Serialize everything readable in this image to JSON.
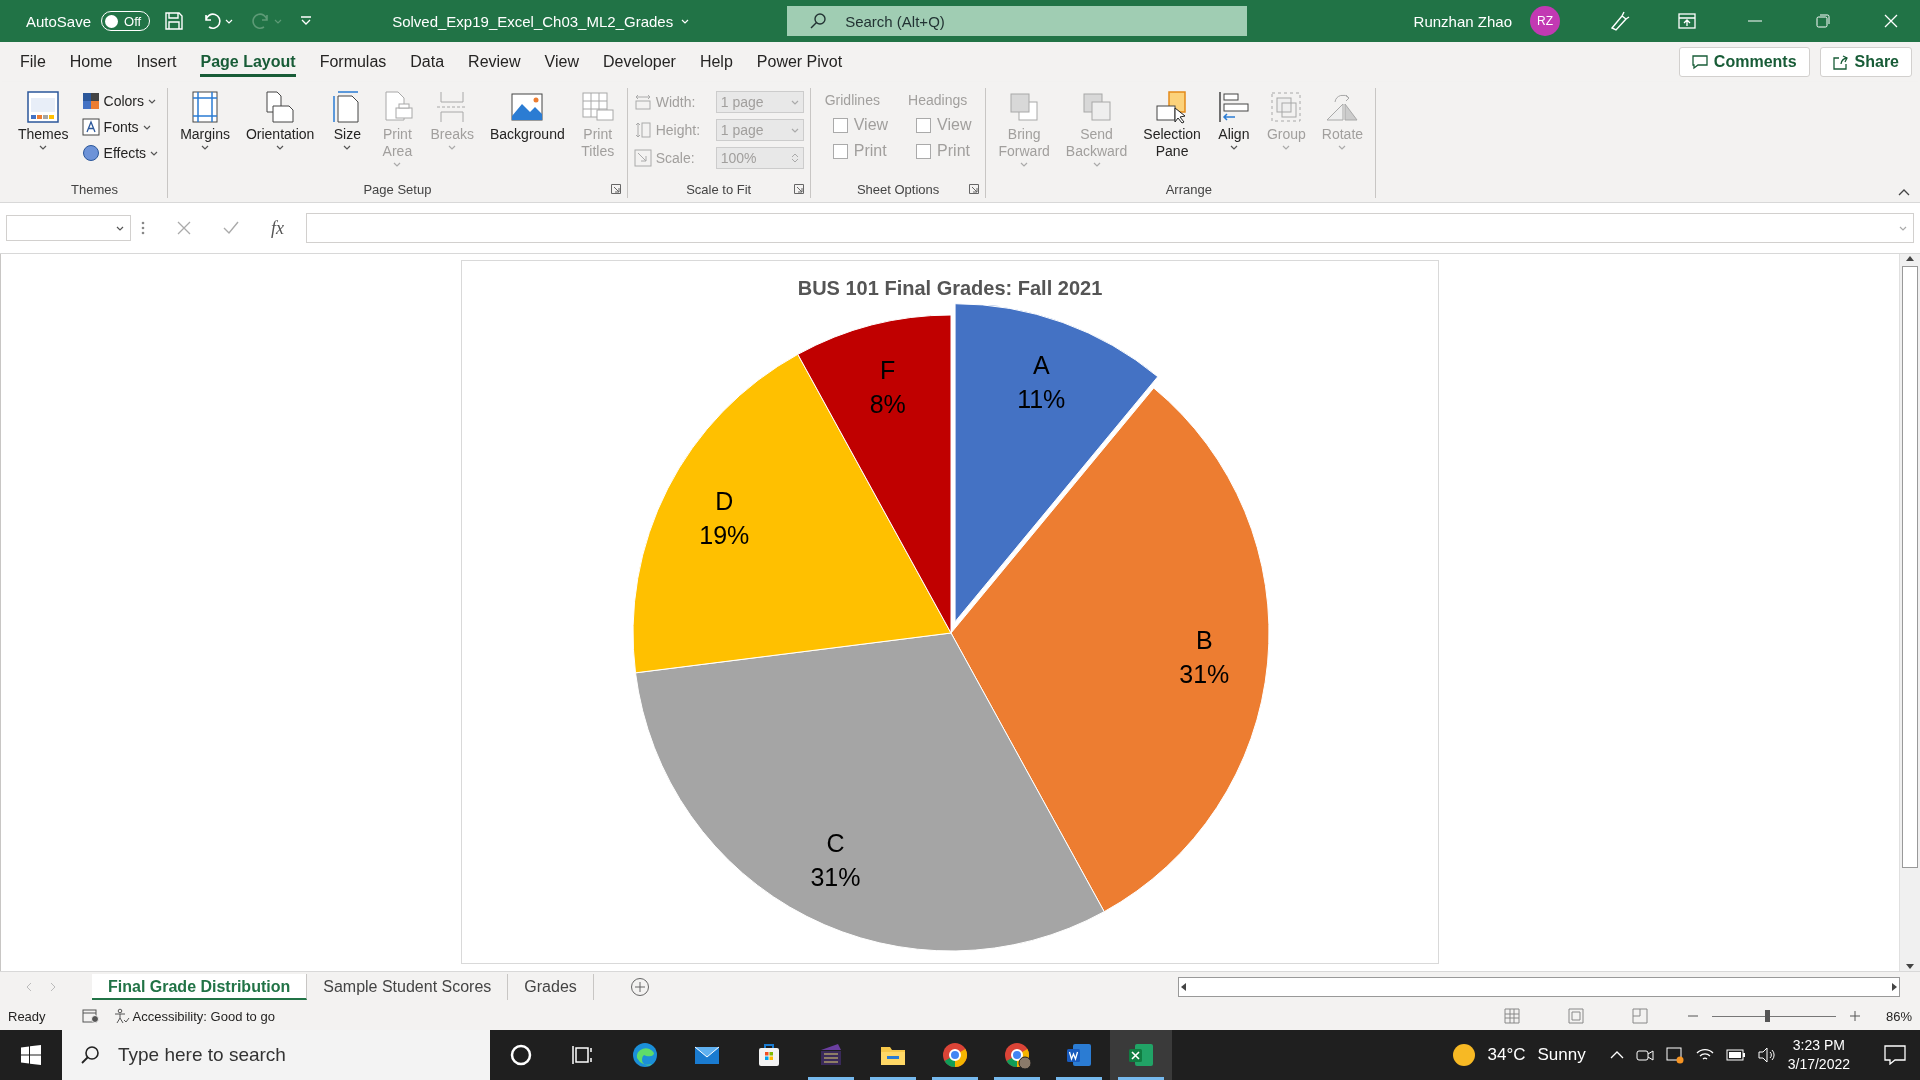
{
  "title_bar": {
    "autosave": {
      "label": "AutoSave",
      "on": false,
      "state_text": "Off"
    },
    "quick_access": [
      {
        "disabled": false
      },
      {
        "disabled": false
      },
      {
        "disabled": true
      },
      {
        "disabled": false
      }
    ],
    "file_name": "Solved_Exp19_Excel_Ch03_ML2_Grades",
    "search": {
      "placeholder": "Search (Alt+Q)"
    },
    "user_name": "Runzhan Zhao",
    "avatar_initials": "RZ"
  },
  "menu_tabs": [
    {
      "label": "File",
      "selected": false
    },
    {
      "label": "Home",
      "selected": false
    },
    {
      "label": "Insert",
      "selected": false
    },
    {
      "label": "Page Layout",
      "selected": true
    },
    {
      "label": "Formulas",
      "selected": false
    },
    {
      "label": "Data",
      "selected": false
    },
    {
      "label": "Review",
      "selected": false
    },
    {
      "label": "View",
      "selected": false
    },
    {
      "label": "Developer",
      "selected": false
    },
    {
      "label": "Help",
      "selected": false
    },
    {
      "label": "Power Pivot",
      "selected": false
    }
  ],
  "header_buttons": [
    "Comments",
    "Share"
  ],
  "ribbon": {
    "groups": [
      {
        "name": "Themes",
        "launcher": false,
        "items": [
          {
            "kind": "large",
            "label": "Themes",
            "dropdown": true,
            "disabled": false
          },
          {
            "kind": "small",
            "label": "Colors",
            "dropdown": true,
            "disabled": false
          },
          {
            "kind": "small",
            "label": "Fonts",
            "dropdown": true,
            "disabled": false
          },
          {
            "kind": "small",
            "label": "Effects",
            "dropdown": true,
            "disabled": false
          }
        ]
      },
      {
        "name": "Page Setup",
        "launcher": true,
        "items": [
          {
            "kind": "large",
            "label": "Margins",
            "dropdown": true,
            "disabled": false
          },
          {
            "kind": "large",
            "label": "Orientation",
            "dropdown": true,
            "disabled": false
          },
          {
            "kind": "large",
            "label": "Size",
            "dropdown": true,
            "disabled": false
          },
          {
            "kind": "large",
            "label": "Print Area",
            "dropdown": true,
            "disabled": true
          },
          {
            "kind": "large",
            "label": "Breaks",
            "dropdown": true,
            "disabled": true
          },
          {
            "kind": "large",
            "label": "Background",
            "dropdown": false,
            "disabled": false
          },
          {
            "kind": "large",
            "label": "Print Titles",
            "dropdown": false,
            "disabled": true
          }
        ]
      },
      {
        "name": "Scale to Fit",
        "launcher": true,
        "items": [
          {
            "kind": "combo",
            "label": "Width:",
            "value": "1 page",
            "disabled": true
          },
          {
            "kind": "combo",
            "label": "Height:",
            "value": "1 page",
            "disabled": true
          },
          {
            "kind": "spin",
            "label": "Scale:",
            "value": "100%",
            "disabled": true
          }
        ]
      },
      {
        "name": "Sheet Options",
        "launcher": true,
        "items": [
          {
            "kind": "checks",
            "label": "Gridlines",
            "disabled": true,
            "checks": [
              {
                "label": "View",
                "checked": false
              },
              {
                "label": "Print",
                "checked": false
              }
            ]
          },
          {
            "kind": "checks",
            "label": "Headings",
            "disabled": true,
            "checks": [
              {
                "label": "View",
                "checked": false
              },
              {
                "label": "Print",
                "checked": false
              }
            ]
          }
        ]
      },
      {
        "name": "Arrange",
        "launcher": false,
        "items": [
          {
            "kind": "large",
            "label": "Bring Forward",
            "dropdown": true,
            "disabled": true
          },
          {
            "kind": "large",
            "label": "Send Backward",
            "dropdown": true,
            "disabled": true
          },
          {
            "kind": "large",
            "label": "Selection Pane",
            "dropdown": false,
            "disabled": false
          },
          {
            "kind": "large",
            "label": "Align",
            "dropdown": true,
            "disabled": false
          },
          {
            "kind": "large",
            "label": "Group",
            "dropdown": true,
            "disabled": true
          },
          {
            "kind": "large",
            "label": "Rotate",
            "dropdown": true,
            "disabled": true
          }
        ]
      }
    ]
  },
  "formula_bar": {
    "fx_label": "fx"
  },
  "chart": {
    "chart_data": {
      "type": "pie",
      "title": "BUS 101 Final Grades: Fall 2021",
      "categories": [
        "A",
        "B",
        "C",
        "D",
        "F"
      ],
      "series": [
        {
          "values": [
            11,
            31,
            31,
            19,
            8
          ]
        }
      ],
      "value_labels": [
        "11%",
        "31%",
        "31%",
        "19%",
        "8%"
      ],
      "colors": [
        "#4472c4",
        "#ed7d31",
        "#a5a5a5",
        "#ffc000",
        "#c00000"
      ]
    },
    "exploded_slices": [
      true,
      false,
      false,
      false,
      false
    ]
  },
  "sheet_tabs": [
    {
      "label": "Final Grade Distribution",
      "selected": true
    },
    {
      "label": "Sample Student Scores",
      "selected": false
    },
    {
      "label": "Grades",
      "selected": false
    }
  ],
  "status_bar": {
    "ready": "Ready",
    "accessibility": "Accessibility: Good to go",
    "zoom": {
      "level": 0.44,
      "reading": "86%"
    }
  },
  "taskbar": {
    "search": {
      "placeholder": "Type here to search"
    },
    "apps": [
      {
        "running": false,
        "selected": false
      },
      {
        "running": false,
        "selected": false
      },
      {
        "running": false,
        "selected": false
      },
      {
        "running": false,
        "selected": false
      },
      {
        "running": false,
        "selected": false
      },
      {
        "running": true,
        "selected": false
      },
      {
        "running": true,
        "selected": false
      },
      {
        "running": true,
        "selected": false
      },
      {
        "running": true,
        "selected": false
      },
      {
        "running": true,
        "selected": false
      },
      {
        "running": true,
        "selected": true
      }
    ],
    "weather": {
      "temperature": "34°C",
      "condition": "Sunny"
    },
    "time": "3:23 PM",
    "date": "3/17/2022"
  }
}
